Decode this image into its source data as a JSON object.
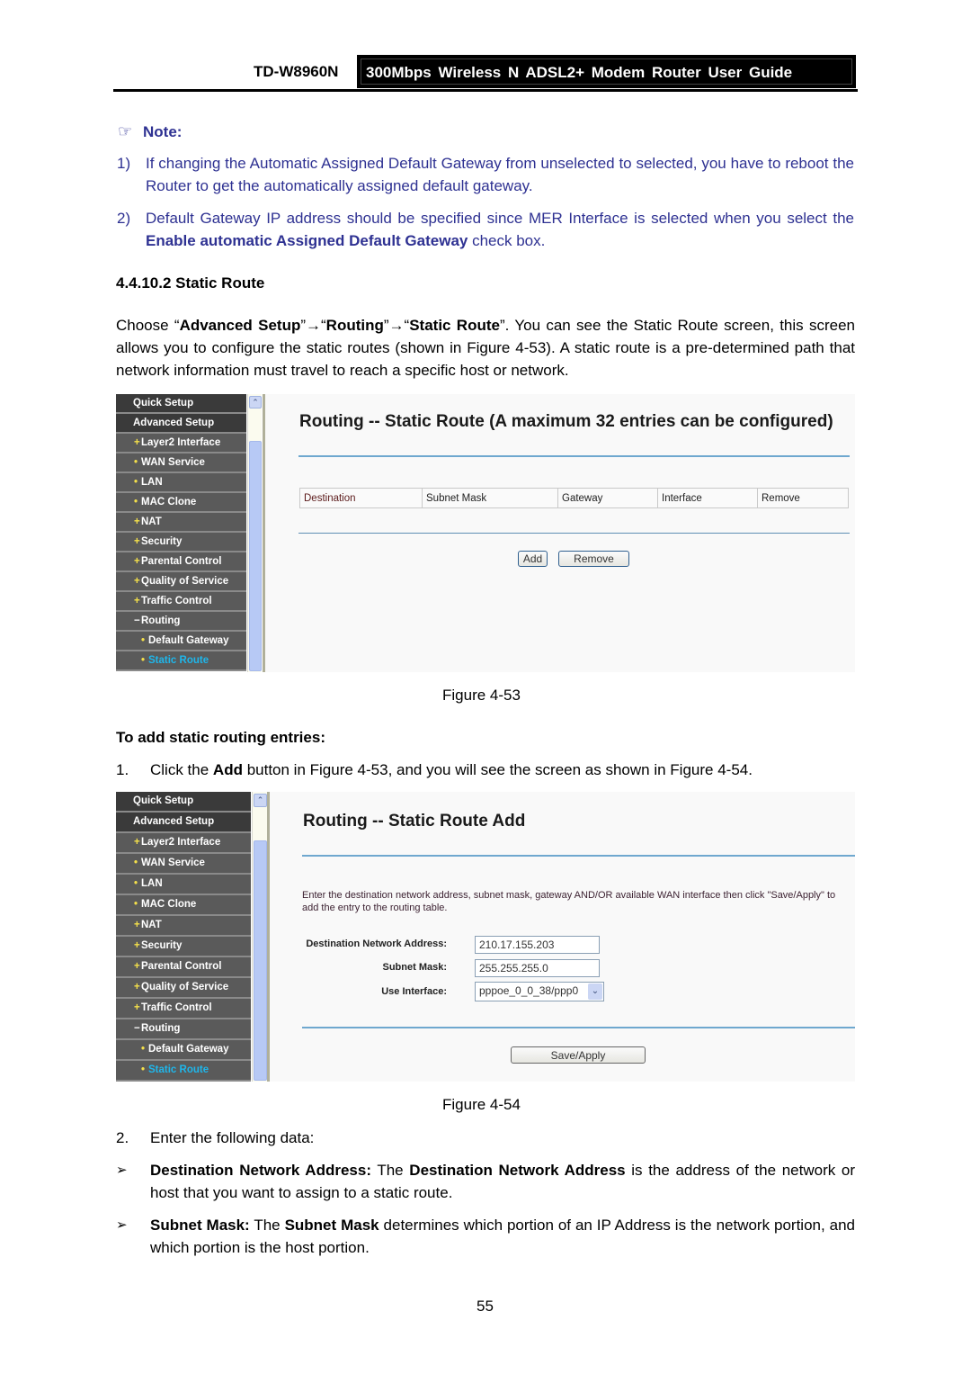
{
  "header": {
    "model": "TD-W8960N",
    "guide_title": "300Mbps Wireless N ADSL2+ Modem Router User Guide"
  },
  "note": {
    "icon": "pointing-hand-icon",
    "title": "Note:",
    "items": [
      {
        "num": "1)",
        "text": "If changing the Automatic Assigned Default Gateway from unselected to selected, you have to reboot the Router to get the automatically assigned default gateway."
      },
      {
        "num": "2)",
        "text_before": "Default Gateway IP address should be specified since MER Interface is selected when you select the ",
        "text_bold": "Enable automatic Assigned Default Gateway",
        "text_after": " check box."
      }
    ]
  },
  "section": {
    "heading": "4.4.10.2 Static Route",
    "intro": {
      "p1": "Choose “",
      "b1": "Advanced Setup",
      "p2": "”→“",
      "b2": "Routing",
      "p3": "”→“",
      "b3": "Static Route",
      "p4": "”. You can see the Static Route screen, this screen allows you to configure the static routes (shown in Figure 4-53). A static route is a pre-determined path that network information must travel to reach a specific host or network."
    }
  },
  "sidebar": {
    "items": [
      {
        "label": "Quick Setup",
        "bullet": ""
      },
      {
        "label": "Advanced Setup",
        "bullet": ""
      },
      {
        "label": "Layer2 Interface",
        "bullet": "+"
      },
      {
        "label": "WAN Service",
        "bullet": "•"
      },
      {
        "label": "LAN",
        "bullet": "•"
      },
      {
        "label": "MAC Clone",
        "bullet": "•"
      },
      {
        "label": "NAT",
        "bullet": "+"
      },
      {
        "label": "Security",
        "bullet": "+"
      },
      {
        "label": "Parental Control",
        "bullet": "+"
      },
      {
        "label": "Quality of Service",
        "bullet": "+"
      },
      {
        "label": "Traffic Control",
        "bullet": "+"
      },
      {
        "label": "Routing",
        "bullet": "−"
      },
      {
        "label": "Default Gateway",
        "bullet": "•"
      },
      {
        "label": "Static Route",
        "bullet": "•"
      }
    ],
    "active": "Static Route",
    "active_color": "#1fb6ea"
  },
  "figure53": {
    "title": "Routing -- Static Route (A maximum 32 entries can be configured)",
    "columns": [
      "Destination",
      "Subnet Mask",
      "Gateway",
      "Interface",
      "Remove"
    ],
    "add_label": "Add",
    "remove_label": "Remove",
    "caption": "Figure 4-53"
  },
  "steps": {
    "heading": "To add static routing entries:",
    "step1": {
      "num": "1.",
      "pre": "Click the ",
      "bold": "Add",
      "post": " button in Figure 4-53, and you will see the screen as shown in Figure 4-54."
    },
    "step2": {
      "num": "2.",
      "text": "Enter the following data:"
    }
  },
  "figure54": {
    "title": "Routing -- Static Route Add",
    "description": "Enter the destination network address, subnet mask, gateway AND/OR available WAN interface then click \"Save/Apply\" to add the entry to the routing table.",
    "fields": {
      "dest_label": "Destination Network Address:",
      "dest_value": "210.17.155.203",
      "mask_label": "Subnet Mask:",
      "mask_value": "255.255.255.0",
      "iface_label": "Use Interface:",
      "iface_value": "pppoe_0_0_38/ppp0"
    },
    "save_label": "Save/Apply",
    "caption": "Figure 4-54"
  },
  "definitions": [
    {
      "b1": "Destination Network Address:",
      "t1": " The ",
      "b2": "Destination Network Address",
      "t2": " is the address of the network or host that you want to assign to a static route."
    },
    {
      "b1": "Subnet Mask:",
      "t1": " The ",
      "b2": "Subnet Mask",
      "t2": " determines which portion of an IP Address is the network portion, and which portion is the host portion."
    }
  ],
  "bullet_glyph": "➢",
  "page_number": "55"
}
